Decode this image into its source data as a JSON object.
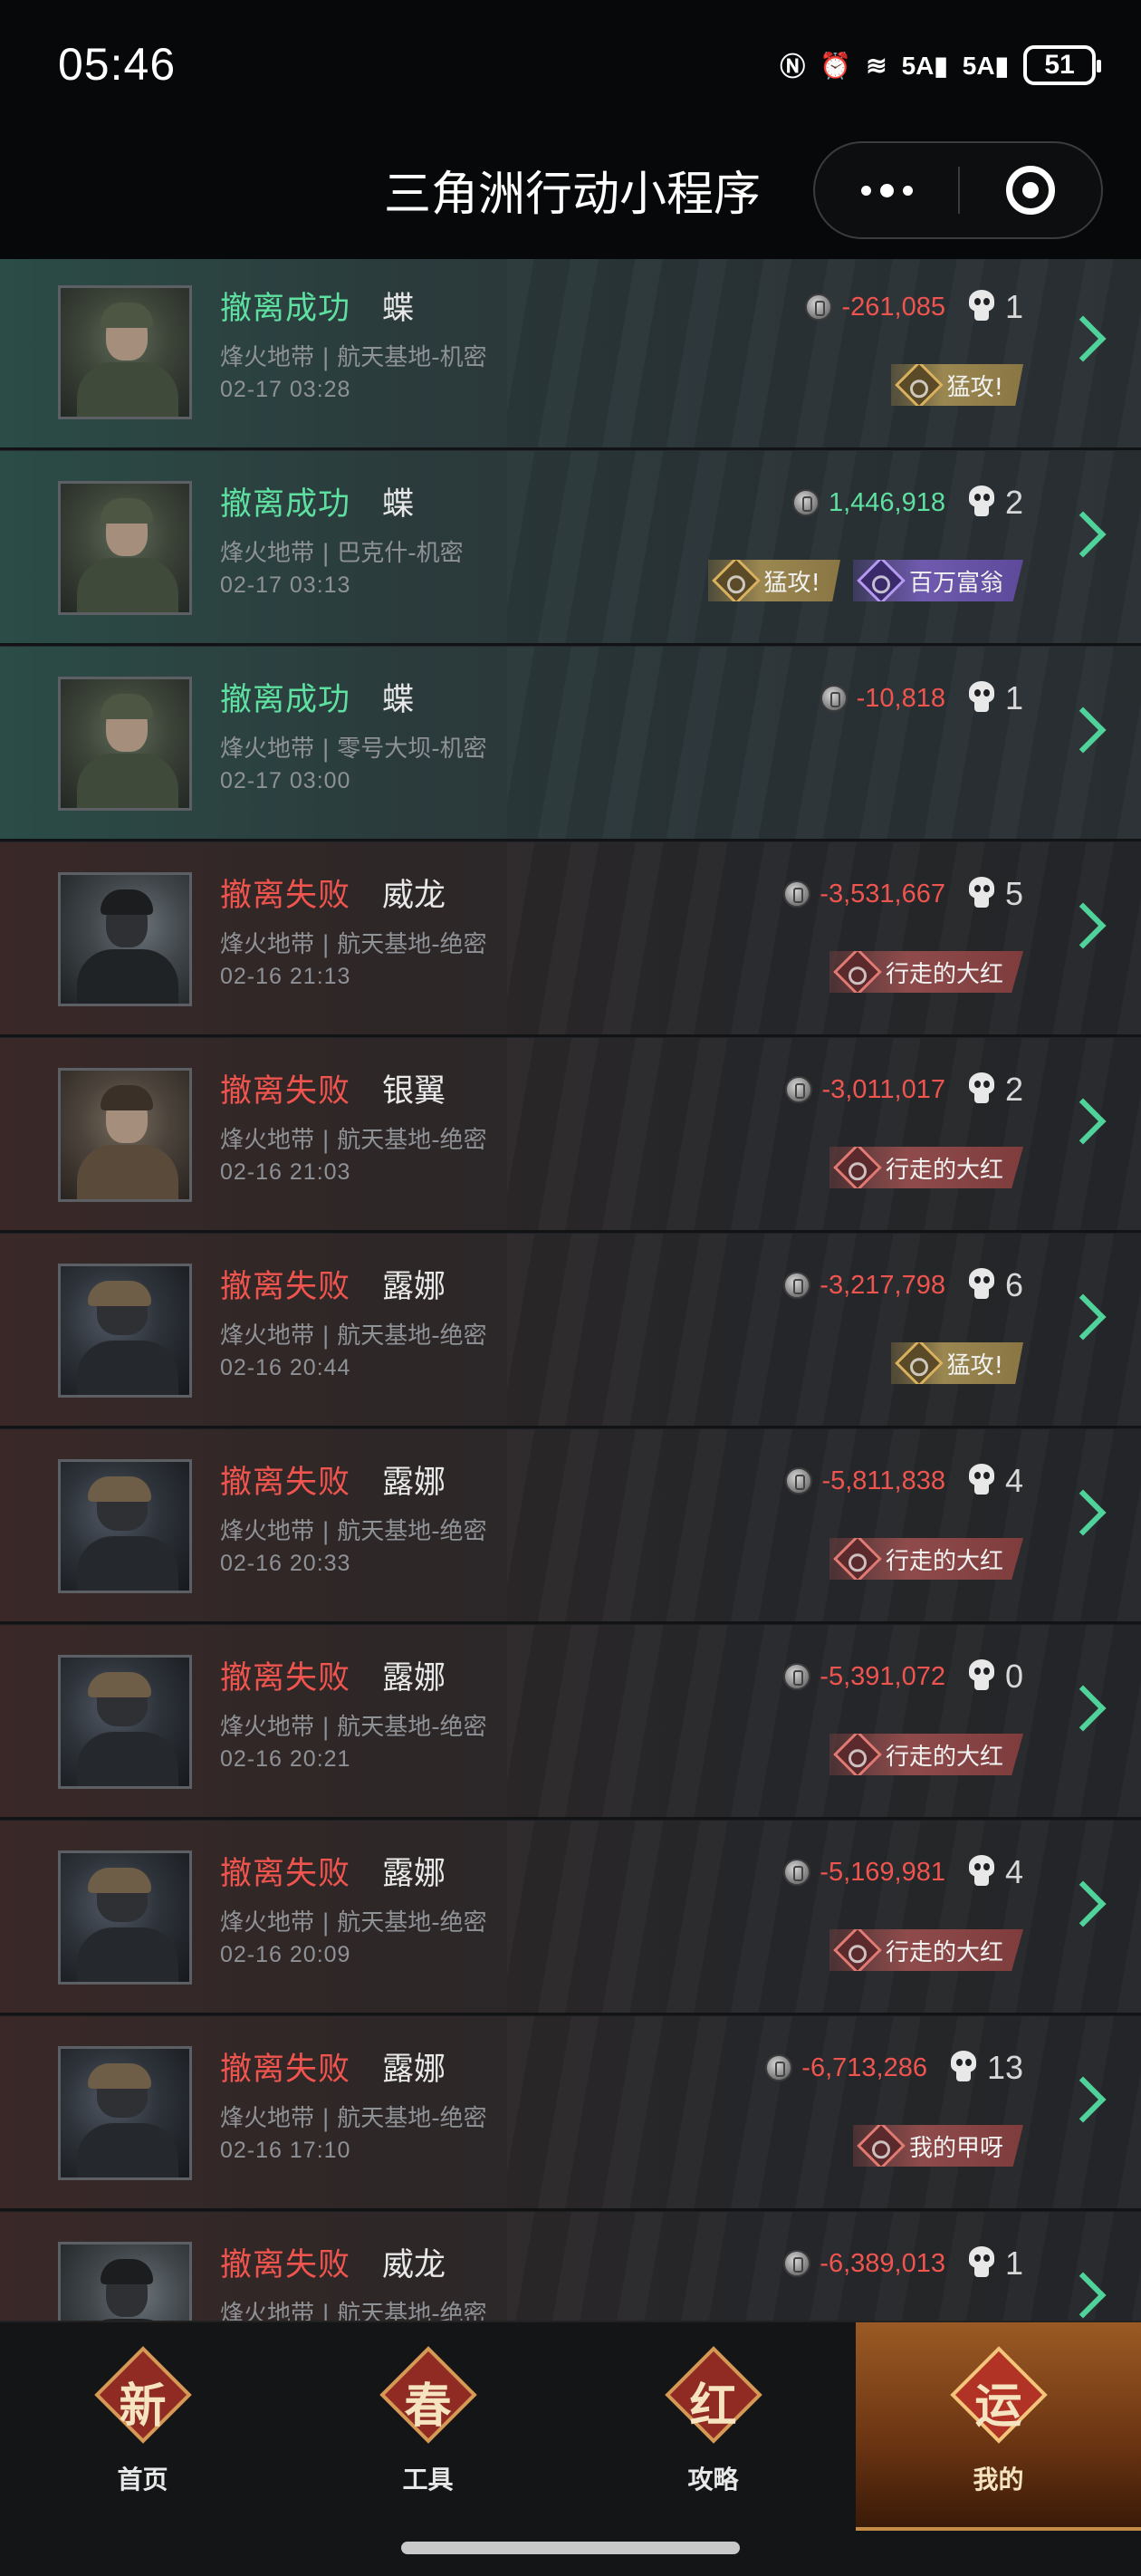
{
  "status_bar": {
    "time": "05:46",
    "icons": [
      "nfc-icon",
      "alarm-icon",
      "wifi-icon",
      "signal-5a-icon",
      "signal-5a-icon"
    ],
    "net1": "5A",
    "net2": "5A",
    "battery": "51"
  },
  "title_bar": {
    "title": "三角洲行动小程序",
    "more_icon": "more-dots-icon",
    "close_icon": "target-close-icon"
  },
  "records": [
    {
      "result": "撤离成功",
      "type": "success",
      "operator": "蝶",
      "char": "die",
      "map": "烽火地带 | 航天基地-机密",
      "time": "02-17 03:28",
      "value": "-261,085",
      "value_sign": "neg",
      "kills": "1",
      "badges": [
        {
          "label": "猛攻!",
          "style": "gold"
        }
      ]
    },
    {
      "result": "撤离成功",
      "type": "success",
      "operator": "蝶",
      "char": "die",
      "map": "烽火地带 | 巴克什-机密",
      "time": "02-17 03:13",
      "value": "1,446,918",
      "value_sign": "pos",
      "kills": "2",
      "badges": [
        {
          "label": "猛攻!",
          "style": "gold"
        },
        {
          "label": "百万富翁",
          "style": "purple"
        }
      ]
    },
    {
      "result": "撤离成功",
      "type": "success",
      "operator": "蝶",
      "char": "die",
      "map": "烽火地带 | 零号大坝-机密",
      "time": "02-17 03:00",
      "value": "-10,818",
      "value_sign": "neg",
      "kills": "1",
      "badges": []
    },
    {
      "result": "撤离失败",
      "type": "fail",
      "operator": "威龙",
      "char": "wei",
      "map": "烽火地带 | 航天基地-绝密",
      "time": "02-16 21:13",
      "value": "-3,531,667",
      "value_sign": "neg",
      "kills": "5",
      "badges": [
        {
          "label": "行走的大红",
          "style": "red"
        }
      ]
    },
    {
      "result": "撤离失败",
      "type": "fail",
      "operator": "银翼",
      "char": "yin",
      "map": "烽火地带 | 航天基地-绝密",
      "time": "02-16 21:03",
      "value": "-3,011,017",
      "value_sign": "neg",
      "kills": "2",
      "badges": [
        {
          "label": "行走的大红",
          "style": "red"
        }
      ]
    },
    {
      "result": "撤离失败",
      "type": "fail",
      "operator": "露娜",
      "char": "lu",
      "map": "烽火地带 | 航天基地-绝密",
      "time": "02-16 20:44",
      "value": "-3,217,798",
      "value_sign": "neg",
      "kills": "6",
      "badges": [
        {
          "label": "猛攻!",
          "style": "gold"
        }
      ]
    },
    {
      "result": "撤离失败",
      "type": "fail",
      "operator": "露娜",
      "char": "lu",
      "map": "烽火地带 | 航天基地-绝密",
      "time": "02-16 20:33",
      "value": "-5,811,838",
      "value_sign": "neg",
      "kills": "4",
      "badges": [
        {
          "label": "行走的大红",
          "style": "red"
        }
      ]
    },
    {
      "result": "撤离失败",
      "type": "fail",
      "operator": "露娜",
      "char": "lu",
      "map": "烽火地带 | 航天基地-绝密",
      "time": "02-16 20:21",
      "value": "-5,391,072",
      "value_sign": "neg",
      "kills": "0",
      "badges": [
        {
          "label": "行走的大红",
          "style": "red"
        }
      ]
    },
    {
      "result": "撤离失败",
      "type": "fail",
      "operator": "露娜",
      "char": "lu",
      "map": "烽火地带 | 航天基地-绝密",
      "time": "02-16 20:09",
      "value": "-5,169,981",
      "value_sign": "neg",
      "kills": "4",
      "badges": [
        {
          "label": "行走的大红",
          "style": "red"
        }
      ]
    },
    {
      "result": "撤离失败",
      "type": "fail",
      "operator": "露娜",
      "char": "lu",
      "map": "烽火地带 | 航天基地-绝密",
      "time": "02-16 17:10",
      "value": "-6,713,286",
      "value_sign": "neg",
      "kills": "13",
      "badges": [
        {
          "label": "我的甲呀",
          "style": "red"
        }
      ]
    },
    {
      "result": "撤离失败",
      "type": "fail",
      "operator": "威龙",
      "char": "wei",
      "map": "烽火地带 | 航天基地-绝密",
      "time": "",
      "value": "-6,389,013",
      "value_sign": "neg",
      "kills": "1",
      "badges": []
    }
  ],
  "tabbar": {
    "tabs": [
      {
        "char": "新",
        "label": "首页",
        "active": false
      },
      {
        "char": "春",
        "label": "工具",
        "active": false
      },
      {
        "char": "红",
        "label": "攻略",
        "active": false
      },
      {
        "char": "运",
        "label": "我的",
        "active": true
      }
    ]
  }
}
